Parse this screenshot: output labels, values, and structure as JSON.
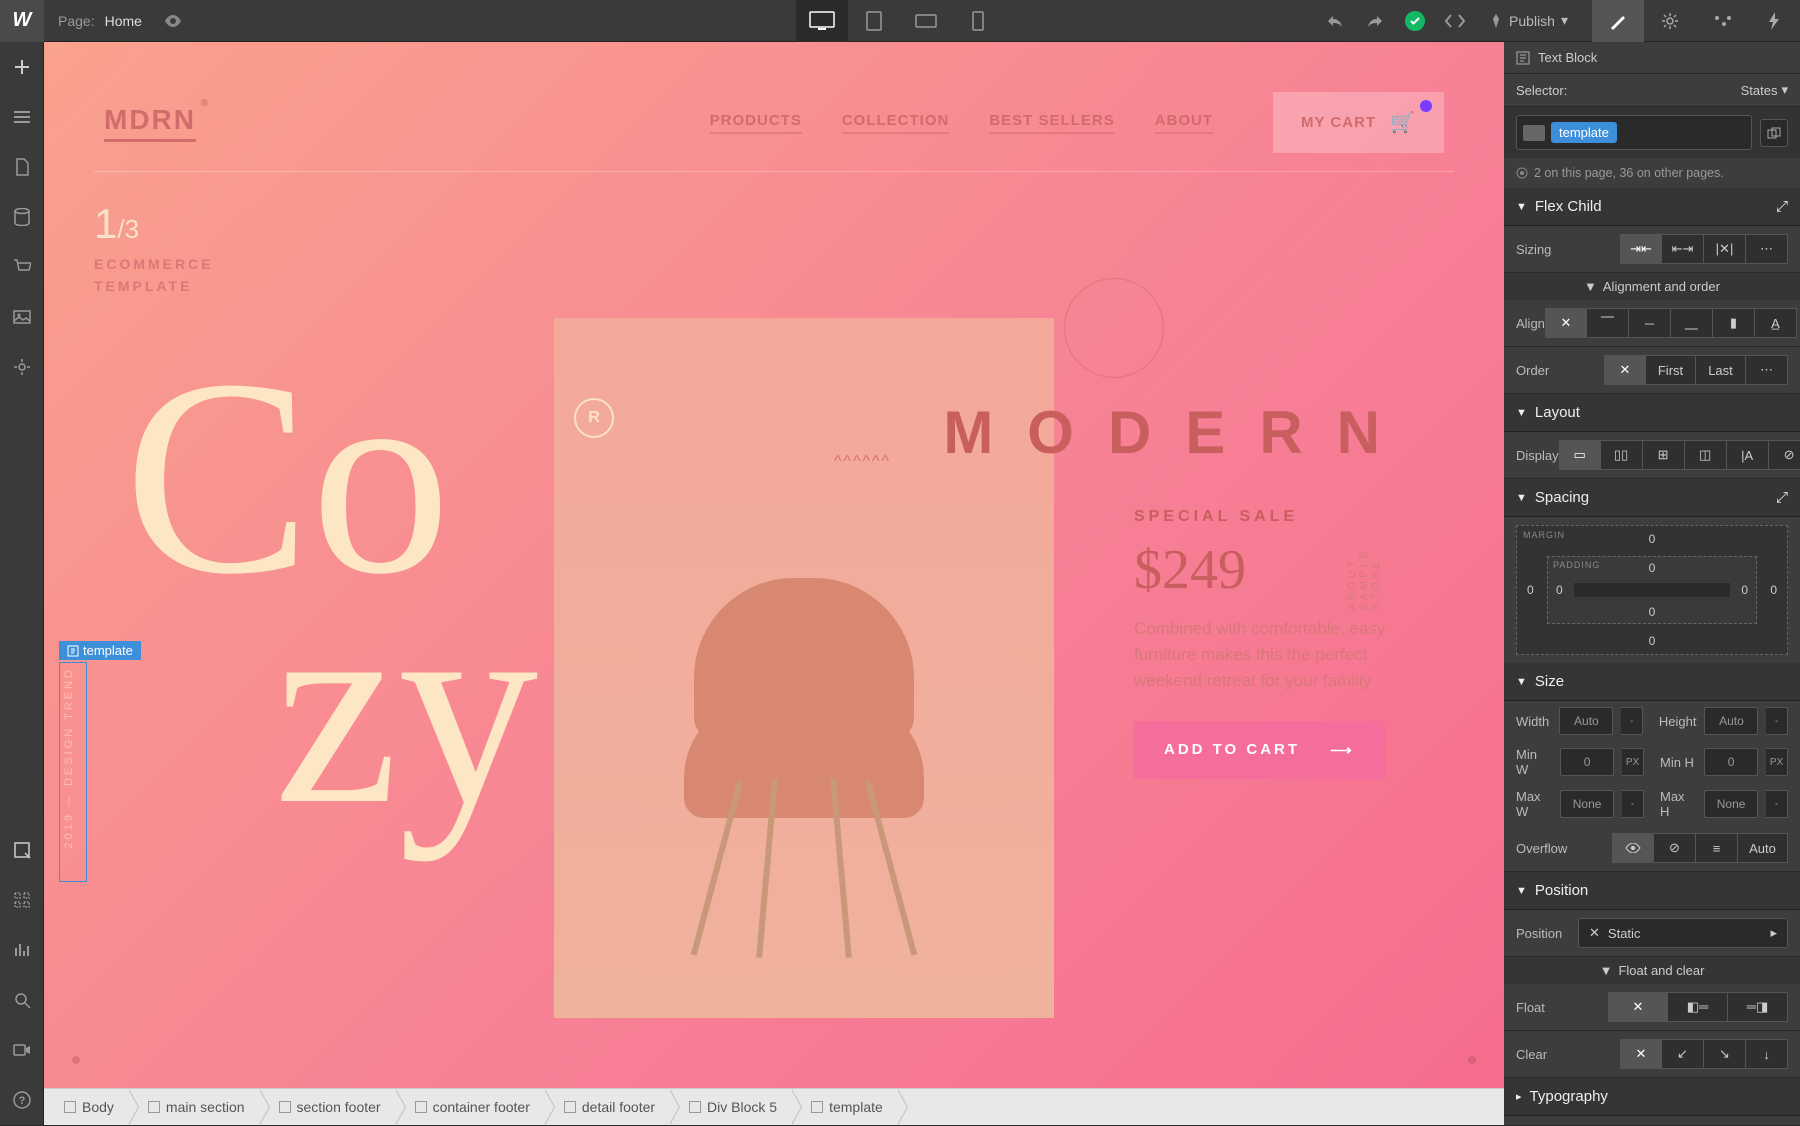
{
  "topbar": {
    "page_label": "Page:",
    "page_name": "Home",
    "publish_label": "Publish"
  },
  "canvas": {
    "brand": "MDRN",
    "brand_sup": "®",
    "nav": [
      "PRODUCTS",
      "COLLECTION",
      "BEST SELLERS",
      "ABOUT"
    ],
    "cart_label": "MY CART",
    "counter_num": "1",
    "counter_total": "/3",
    "sub_label_1": "ECOMMERCE",
    "sub_label_2": "TEMPLATE",
    "big_1": "Co",
    "big_2": "zy",
    "modern": "MODERN",
    "wavy": "^^^^^^",
    "reg": "R",
    "sale_label": "SPECIAL SALE",
    "price": "$249",
    "desc": "Combined with comfortable, easy furniture makes this the perfect weekend retreat for your familiy",
    "add_cart": "ADD TO CART",
    "arrow": "⟶",
    "vert_text": "ABOUT SAMPLE STORE",
    "trend_text": "2019 — DESIGN TREND",
    "selected_tag": "template"
  },
  "breadcrumb": [
    "Body",
    "main section",
    "section footer",
    "container footer",
    "detail footer",
    "Div Block 5",
    "template"
  ],
  "panel": {
    "element_type": "Text Block",
    "selector_label": "Selector:",
    "states_label": "States",
    "selector_value": "template",
    "usage_info": "2 on this page, 36 on other pages.",
    "sections": {
      "flex_child": "Flex Child",
      "layout": "Layout",
      "spacing": "Spacing",
      "size": "Size",
      "position": "Position",
      "typography": "Typography"
    },
    "sub_alignment": "Alignment and order",
    "sub_float": "Float and clear",
    "labels": {
      "sizing": "Sizing",
      "align": "Align",
      "order": "Order",
      "display": "Display",
      "width": "Width",
      "height": "Height",
      "minw": "Min W",
      "minh": "Min H",
      "maxw": "Max W",
      "maxh": "Max H",
      "overflow": "Overflow",
      "position": "Position",
      "float": "Float",
      "clear": "Clear"
    },
    "order_opts": [
      "First",
      "Last"
    ],
    "margin_label": "MARGIN",
    "padding_label": "PADDING",
    "spacing_vals": {
      "mt": "0",
      "mr": "0",
      "mb": "0",
      "ml": "0",
      "pt": "0",
      "pr": "0",
      "pb": "0",
      "pl": "0"
    },
    "size_vals": {
      "width": "Auto",
      "height": "Auto",
      "minw": "0",
      "minh": "0",
      "maxw": "None",
      "maxh": "None",
      "unit": "PX",
      "dash": "-"
    },
    "overflow_auto": "Auto",
    "position_value": "Static"
  }
}
